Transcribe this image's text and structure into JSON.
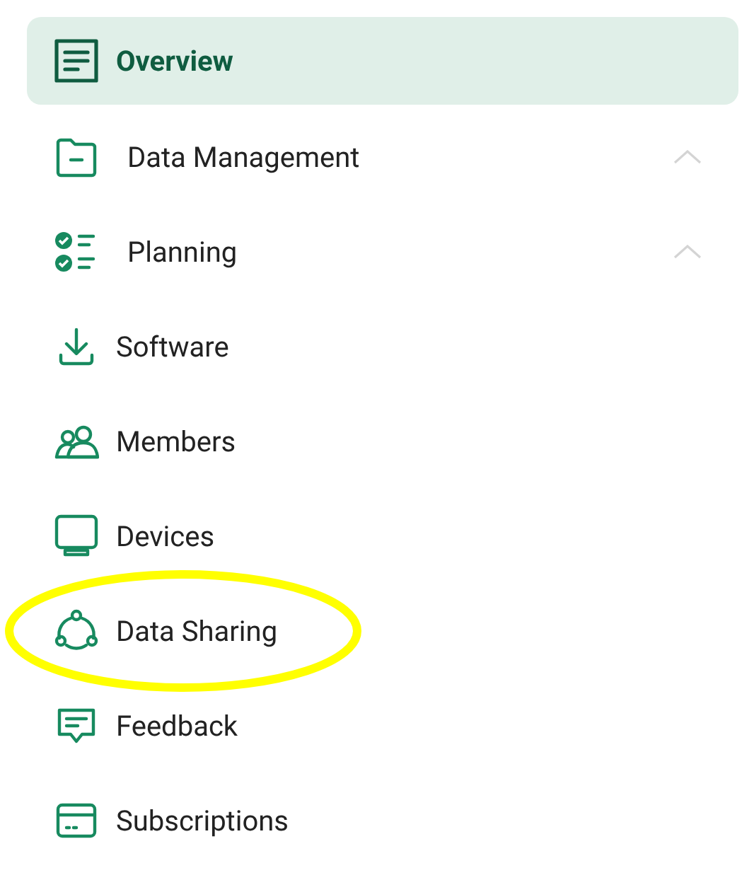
{
  "nav": {
    "items": [
      {
        "label": "Overview",
        "kind": "link",
        "selected": true,
        "highlighted": false
      },
      {
        "label": "Data Management",
        "kind": "group",
        "selected": false,
        "highlighted": false
      },
      {
        "label": "Planning",
        "kind": "group",
        "selected": false,
        "highlighted": false
      },
      {
        "label": "Software",
        "kind": "link",
        "selected": false,
        "highlighted": false
      },
      {
        "label": "Members",
        "kind": "link",
        "selected": false,
        "highlighted": false
      },
      {
        "label": "Devices",
        "kind": "link",
        "selected": false,
        "highlighted": false
      },
      {
        "label": "Data Sharing",
        "kind": "link",
        "selected": false,
        "highlighted": true
      },
      {
        "label": "Feedback",
        "kind": "link",
        "selected": false,
        "highlighted": false
      },
      {
        "label": "Subscriptions",
        "kind": "link",
        "selected": false,
        "highlighted": false
      }
    ]
  }
}
